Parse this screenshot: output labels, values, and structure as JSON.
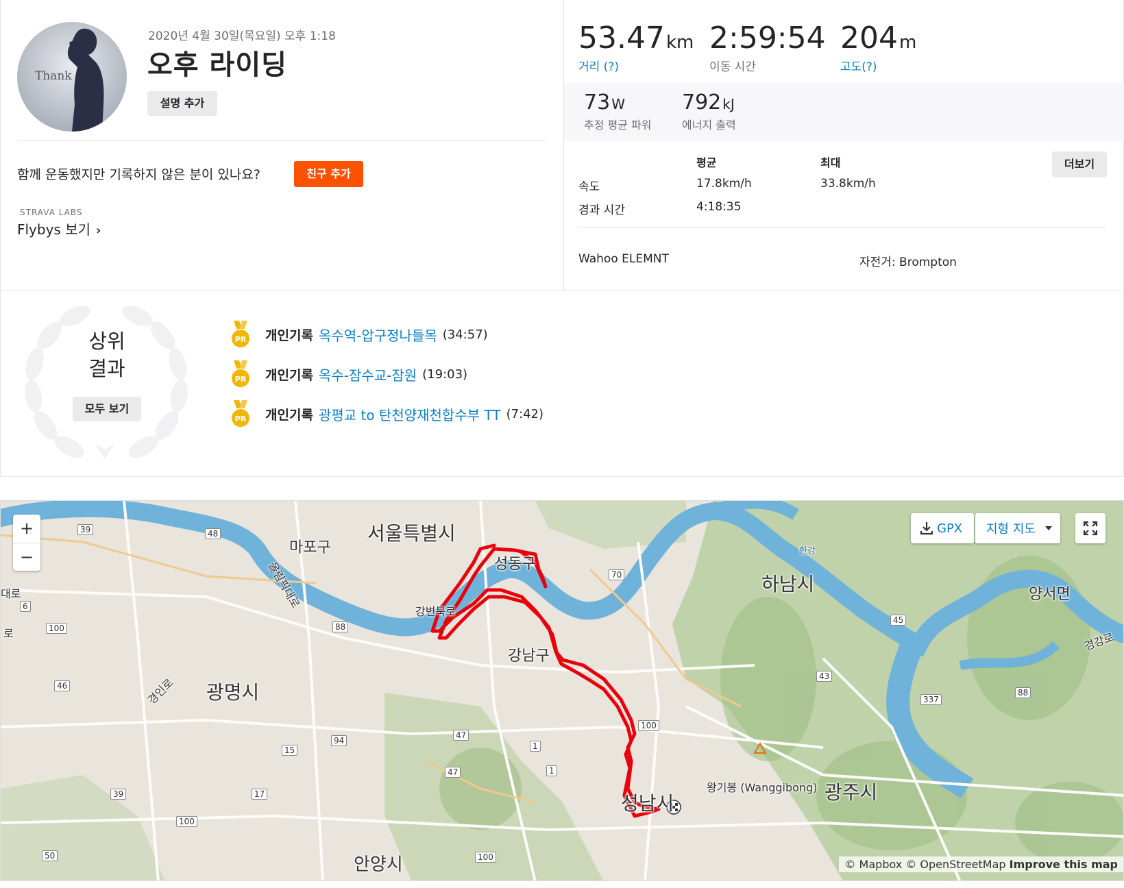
{
  "activity": {
    "date": "2020년 4월 30일(목요일) 오후 1:18",
    "title": "오후 라이딩",
    "add_description": "설명 추가",
    "avatar_text": "Thank"
  },
  "friends": {
    "question": "함께 운동했지만 기록하지 않은 분이 있나요?",
    "add_friend": "친구 추가"
  },
  "labs": {
    "label": "STRAVA LABS",
    "flybys": "Flybys 보기",
    "chevron": "›"
  },
  "stats": {
    "distance": {
      "value": "53.47",
      "unit": "km",
      "label": "거리 (?)"
    },
    "moving_time": {
      "value": "2:59:54",
      "label": "이동 시간"
    },
    "elevation": {
      "value": "204",
      "unit": "m",
      "label": "고도(?)"
    },
    "power": {
      "value": "73",
      "unit": "W",
      "label": "추정 평균 파워"
    },
    "energy": {
      "value": "792",
      "unit": "kJ",
      "label": "에너지 출력"
    }
  },
  "details": {
    "col_avg": "평균",
    "col_max": "최대",
    "more": "더보기",
    "rows": [
      {
        "label": "속도",
        "avg": "17.8km/h",
        "max": "33.8km/h"
      },
      {
        "label": "경과 시간",
        "avg": "4:18:35",
        "max": ""
      }
    ],
    "device": "Wahoo ELEMNT",
    "bike": "자전거: Brompton"
  },
  "achievements": {
    "title_line1": "상위",
    "title_line2": "결과",
    "see_all": "모두 보기",
    "medal_text": "PR",
    "items": [
      {
        "kind": "개인기록",
        "segment": "옥수역-압구정나들목",
        "time": "(34:57)"
      },
      {
        "kind": "개인기록",
        "segment": "옥수-잠수교-잠원",
        "time": "(19:03)"
      },
      {
        "kind": "개인기록",
        "segment": "광평교 to 탄천양재천합수부 TT",
        "time": "(7:42)"
      }
    ]
  },
  "map": {
    "zoom_in": "+",
    "zoom_out": "−",
    "gpx": "GPX",
    "terrain": "지형 지도",
    "attribution_mapbox": "© Mapbox",
    "attribution_osm": "© OpenStreetMap",
    "improve": "Improve this map",
    "colors": {
      "route": "#e8000b",
      "water": "#6fb2da",
      "land": "#e9e4dc",
      "green": "#b5cf9e"
    },
    "labels": {
      "seoul": "서울특별시",
      "mapo": "마포구",
      "seongdong": "성동구",
      "gangnam": "강남구",
      "hanam": "하남시",
      "gwangmyeong": "광명시",
      "seongnam": "성남시",
      "gwangju": "광주시",
      "yangseo": "양서면",
      "anyang": "안양시",
      "wanggibong": "왕기봉 (Wanggibong)",
      "hangang": "한강",
      "gangbyeon": "강변북로",
      "olympic": "올림픽대로",
      "gyeongin": "경인로",
      "gyeonggang": "경강로",
      "daero": "대로",
      "ro": "로"
    },
    "shields": [
      "39",
      "48",
      "6",
      "100",
      "88",
      "70",
      "45",
      "43",
      "88",
      "337",
      "46",
      "94",
      "47",
      "1",
      "15",
      "47",
      "1",
      "100",
      "39",
      "17",
      "100",
      "50",
      "100"
    ]
  }
}
